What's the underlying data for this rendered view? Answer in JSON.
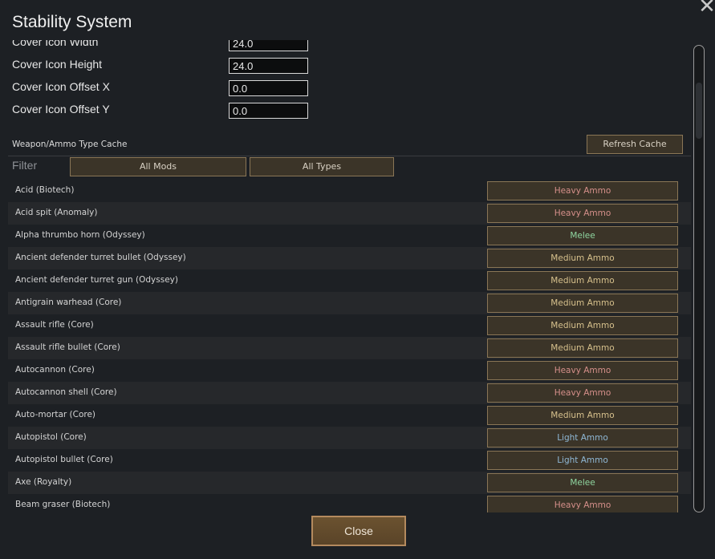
{
  "window": {
    "title": "Stability System",
    "close_icon": "close-x-icon"
  },
  "fields": [
    {
      "label": "Cover Icon Width",
      "value": "24.0"
    },
    {
      "label": "Cover Icon Height",
      "value": "24.0"
    },
    {
      "label": "Cover Icon Offset X",
      "value": "0.0"
    },
    {
      "label": "Cover Icon Offset Y",
      "value": "0.0"
    }
  ],
  "cache": {
    "title": "Weapon/Ammo Type Cache",
    "refresh_label": "Refresh Cache"
  },
  "filter": {
    "label": "Filter",
    "mods_label": "All Mods",
    "types_label": "All Types"
  },
  "colors": {
    "heavy": "#d58f8a",
    "medium": "#d6c08c",
    "melee": "#8fd6a0",
    "light": "#8fb8d6"
  },
  "rows": [
    {
      "name": "Acid (Biotech)",
      "type": "Heavy Ammo",
      "kind": "heavy"
    },
    {
      "name": "Acid spit (Anomaly)",
      "type": "Heavy Ammo",
      "kind": "heavy"
    },
    {
      "name": "Alpha thrumbo horn (Odyssey)",
      "type": "Melee",
      "kind": "melee"
    },
    {
      "name": "Ancient defender turret bullet (Odyssey)",
      "type": "Medium Ammo",
      "kind": "medium"
    },
    {
      "name": "Ancient defender turret gun (Odyssey)",
      "type": "Medium Ammo",
      "kind": "medium"
    },
    {
      "name": "Antigrain warhead (Core)",
      "type": "Medium Ammo",
      "kind": "medium"
    },
    {
      "name": "Assault rifle (Core)",
      "type": "Medium Ammo",
      "kind": "medium"
    },
    {
      "name": "Assault rifle bullet (Core)",
      "type": "Medium Ammo",
      "kind": "medium"
    },
    {
      "name": "Autocannon (Core)",
      "type": "Heavy Ammo",
      "kind": "heavy"
    },
    {
      "name": "Autocannon shell (Core)",
      "type": "Heavy Ammo",
      "kind": "heavy"
    },
    {
      "name": "Auto-mortar (Core)",
      "type": "Medium Ammo",
      "kind": "medium"
    },
    {
      "name": "Autopistol (Core)",
      "type": "Light Ammo",
      "kind": "light"
    },
    {
      "name": "Autopistol bullet (Core)",
      "type": "Light Ammo",
      "kind": "light"
    },
    {
      "name": "Axe (Royalty)",
      "type": "Melee",
      "kind": "melee"
    },
    {
      "name": "Beam graser (Biotech)",
      "type": "Heavy Ammo",
      "kind": "heavy"
    }
  ],
  "footer": {
    "close_label": "Close"
  }
}
